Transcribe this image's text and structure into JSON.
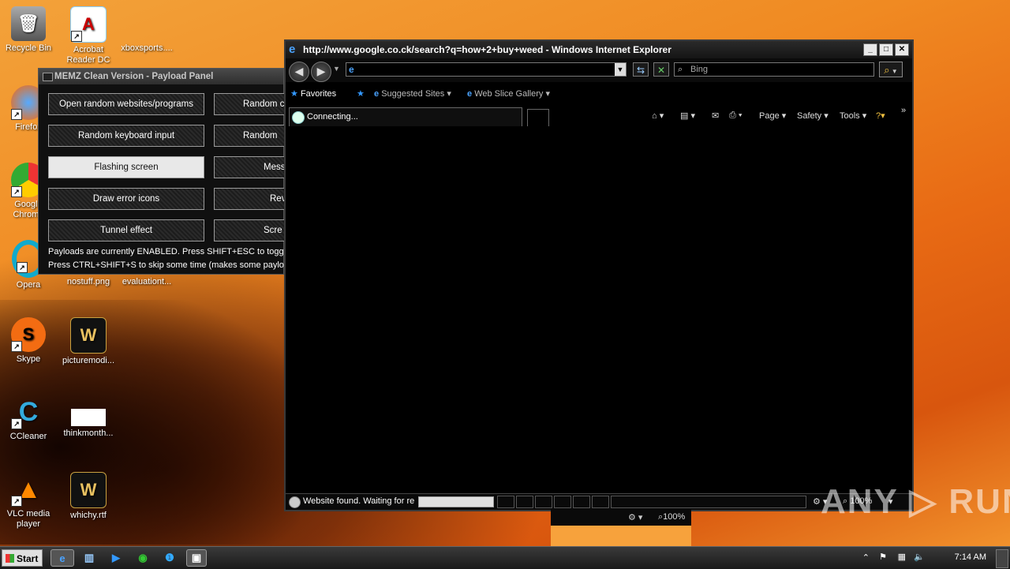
{
  "desktop": {
    "icons": [
      {
        "label": "Recycle Bin"
      },
      {
        "label": "Acrobat Reader DC"
      },
      {
        "label": "xboxsports...."
      },
      {
        "label": "Firefox"
      },
      {
        "label": "Google Chrome"
      },
      {
        "label": "Opera"
      },
      {
        "label": "nostuff.png"
      },
      {
        "label": "evaluationt..."
      },
      {
        "label": "Skype"
      },
      {
        "label": "picturemodi..."
      },
      {
        "label": "CCleaner"
      },
      {
        "label": "thinkmonth..."
      },
      {
        "label": "VLC media player"
      },
      {
        "label": "whichy.rtf"
      }
    ]
  },
  "memz": {
    "title": "MEMZ Clean Version - Payload Panel",
    "buttons": [
      {
        "label": "Open random websites/programs"
      },
      {
        "label": "Random c"
      },
      {
        "label": "Random keyboard input"
      },
      {
        "label": "Random"
      },
      {
        "label": "Flashing screen"
      },
      {
        "label": "Mess"
      },
      {
        "label": "Draw error icons"
      },
      {
        "label": "Rev"
      },
      {
        "label": "Tunnel effect"
      },
      {
        "label": "Scre"
      }
    ],
    "status1": "Payloads are currently ENABLED. Press SHIFT+ESC to toggle",
    "status2": "Press CTRL+SHIFT+S to skip some time (makes some payload"
  },
  "ie": {
    "title": "http://www.google.co.ck/search?q=how+2+buy+weed - Windows Internet Explorer",
    "search_placeholder": "Bing",
    "favorites": {
      "favorites_label": "Favorites",
      "suggested": "Suggested Sites",
      "webslice": "Web Slice Gallery"
    },
    "tab_label": "Connecting...",
    "commands": {
      "page": "Page",
      "safety": "Safety",
      "tools": "Tools"
    },
    "status_text": "Website found. Waiting for re",
    "zoom": "100%"
  },
  "ghost": {
    "zoom": "100%"
  },
  "taskbar": {
    "start": "Start",
    "clock": "7:14 AM"
  },
  "watermark": "ANY ▷ RUN"
}
